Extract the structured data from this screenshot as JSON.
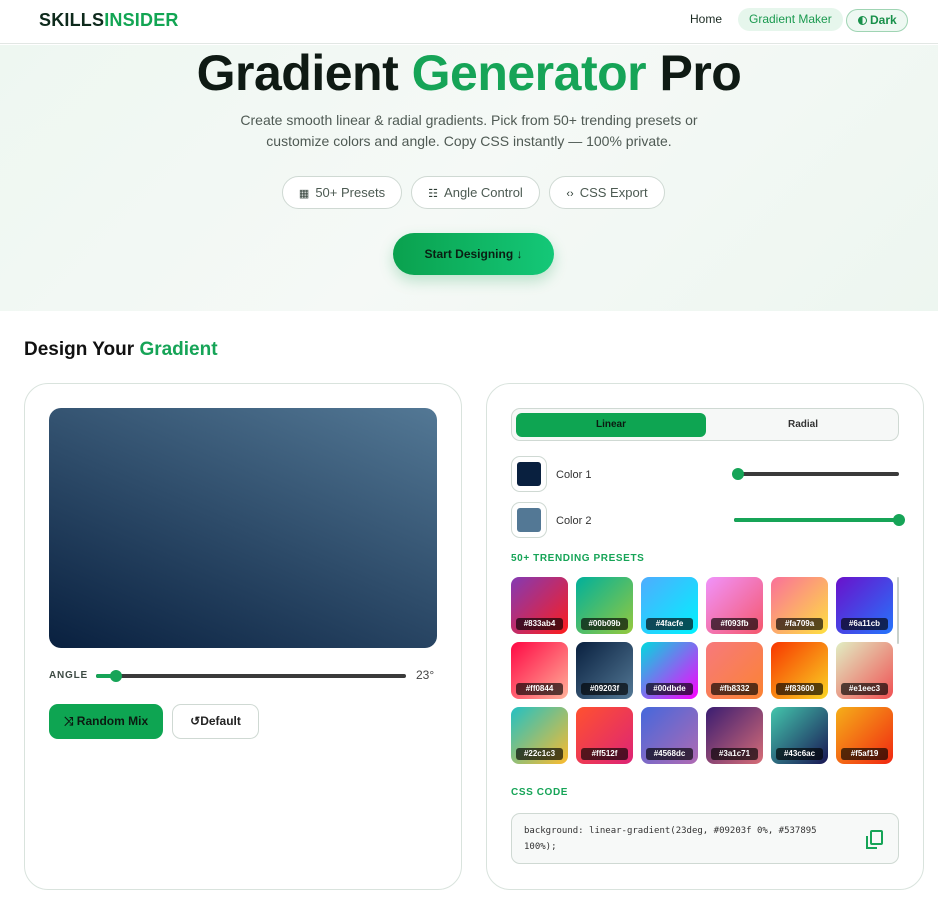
{
  "header": {
    "logo_a": "SKILLS",
    "logo_b": "INSIDER",
    "nav_home": "Home",
    "nav_gradient": "Gradient Maker",
    "dark_label": "Dark"
  },
  "hero": {
    "title_a": "Gradient ",
    "title_b": "Generator",
    "title_c": " Pro",
    "subtitle": "Create smooth linear & radial gradients. Pick from 50+ trending presets or customize colors and angle. Copy CSS instantly — 100% private.",
    "chips": [
      "50+ Presets",
      "Angle Control",
      "CSS Export"
    ],
    "cta": "Start Designing ↓"
  },
  "section": {
    "title_a": "Design Your ",
    "title_b": "Gradient"
  },
  "preview": {
    "angle_label": "ANGLE",
    "angle_value": "23°",
    "angle_fraction": 0.064,
    "random_label": "Random Mix",
    "default_label": "Default",
    "color1_hex": "#09203f",
    "color2_hex": "#537895"
  },
  "controls": {
    "tab_linear": "Linear",
    "tab_radial": "Radial",
    "color1_label": "Color 1",
    "color1_stop": 0,
    "color2_label": "Color 2",
    "color2_stop": 1,
    "presets_title": "50+ TRENDING PRESETS",
    "presets": [
      {
        "label": "#833ab4",
        "from": "#833ab4",
        "to": "#fd1d1d"
      },
      {
        "label": "#00b09b",
        "from": "#00b09b",
        "to": "#96c93d"
      },
      {
        "label": "#4facfe",
        "from": "#4facfe",
        "to": "#00f2fe"
      },
      {
        "label": "#f093fb",
        "from": "#f093fb",
        "to": "#f5576c"
      },
      {
        "label": "#fa709a",
        "from": "#fa709a",
        "to": "#fee140"
      },
      {
        "label": "#6a11cb",
        "from": "#6a11cb",
        "to": "#2575fc"
      },
      {
        "label": "#ff0844",
        "from": "#ff0844",
        "to": "#ffb199"
      },
      {
        "label": "#09203f",
        "from": "#09203f",
        "to": "#537895"
      },
      {
        "label": "#00dbde",
        "from": "#00dbde",
        "to": "#fc00ff"
      },
      {
        "label": "#fb8332",
        "from": "#f7797d",
        "to": "#fb8332"
      },
      {
        "label": "#f83600",
        "from": "#f83600",
        "to": "#f9d423"
      },
      {
        "label": "#e1eec3",
        "from": "#e1eec3",
        "to": "#f05053"
      },
      {
        "label": "#22c1c3",
        "from": "#22c1c3",
        "to": "#fdbb2d"
      },
      {
        "label": "#ff512f",
        "from": "#ff512f",
        "to": "#dd2476"
      },
      {
        "label": "#4568dc",
        "from": "#4568dc",
        "to": "#b06ab3"
      },
      {
        "label": "#3a1c71",
        "from": "#3a1c71",
        "to": "#d76d77"
      },
      {
        "label": "#43c6ac",
        "from": "#43c6ac",
        "to": "#191654"
      },
      {
        "label": "#f5af19",
        "from": "#f5af19",
        "to": "#f12711"
      }
    ],
    "css_title": "CSS CODE",
    "css_code": "background: linear-gradient(23deg, #09203f 0%, #537895 100%);"
  },
  "colors": {
    "accent": "#16a457"
  }
}
